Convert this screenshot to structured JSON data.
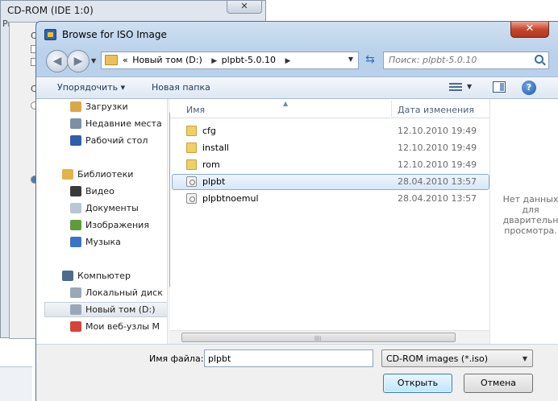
{
  "background_window": {
    "title": "CD-ROM (IDE 1:0)",
    "close_glyph": "✕",
    "fragment_pr": "Pr",
    "fragment_c1": "C",
    "fragment_c2": "C"
  },
  "dialog": {
    "title": "Browse for ISO Image",
    "close_glyph": "✕"
  },
  "address_bar": {
    "back_glyph": "◀",
    "forward_glyph": "▶",
    "prefix": "«",
    "crumbs": [
      "Новый том (D:)",
      "plpbt-5.0.10"
    ],
    "crumb_separator": "▶",
    "dropdown_glyph": "▼",
    "refresh_glyph": "⇆"
  },
  "search": {
    "placeholder": "Поиск: plpbt-5.0.10"
  },
  "toolbar": {
    "organize_label": "Упорядочить ▾",
    "new_folder_label": "Новая папка",
    "view_drop_glyph": "▼",
    "help_label": "?"
  },
  "nav_pane": {
    "items": [
      {
        "label": "Загрузки",
        "icon": "downloads-folder-icon",
        "color": "#d9a84a"
      },
      {
        "label": "Недавние места",
        "icon": "recent-places-icon",
        "color": "#7d8fa8"
      },
      {
        "label": "Рабочий стол",
        "icon": "desktop-icon",
        "color": "#2f5fa8"
      },
      {
        "label": "Библиотеки",
        "icon": "libraries-icon",
        "color": "#e2b34c"
      },
      {
        "label": "Видео",
        "icon": "video-icon",
        "color": "#3a3a3a"
      },
      {
        "label": "Документы",
        "icon": "documents-icon",
        "color": "#b9c6d4"
      },
      {
        "label": "Изображения",
        "icon": "pictures-icon",
        "color": "#5f9a3c"
      },
      {
        "label": "Музыка",
        "icon": "music-icon",
        "color": "#3a74c5"
      },
      {
        "label": "Компьютер",
        "icon": "computer-icon",
        "color": "#4e6a8c"
      },
      {
        "label": "Локальный диск",
        "icon": "local-disk-icon",
        "color": "#9aa8b6"
      },
      {
        "label": "Новый том (D:)",
        "icon": "volume-icon",
        "color": "#9aa8b6"
      },
      {
        "label": "Мои веб-узлы M",
        "icon": "web-sites-icon",
        "color": "#d6433a"
      }
    ]
  },
  "file_list": {
    "columns": {
      "name": "Имя",
      "date": "Дата изменения"
    },
    "sort_glyph": "▲",
    "rows": [
      {
        "name": "cfg",
        "date": "12.10.2010 19:49",
        "type": "folder"
      },
      {
        "name": "install",
        "date": "12.10.2010 19:49",
        "type": "folder"
      },
      {
        "name": "rom",
        "date": "12.10.2010 19:49",
        "type": "folder"
      },
      {
        "name": "plpbt",
        "date": "28.04.2010 13:57",
        "type": "file",
        "selected": true
      },
      {
        "name": "plpbtnoemul",
        "date": "28.04.2010 13:57",
        "type": "file"
      }
    ],
    "scroll_grip": "||||"
  },
  "preview": {
    "text_line1": "Нет данных",
    "text_line2": "для",
    "text_line3": "дварительн",
    "text_line4": "просмотра."
  },
  "scroll": {
    "up_glyph": "▲",
    "down_glyph": "▼"
  },
  "footer": {
    "filename_label": "Имя файла:",
    "filename_value": "plpbt",
    "filter_value": "CD-ROM images (*.iso)",
    "filter_drop_glyph": "▼",
    "open_label": "Открыть",
    "cancel_label": "Отмена"
  }
}
